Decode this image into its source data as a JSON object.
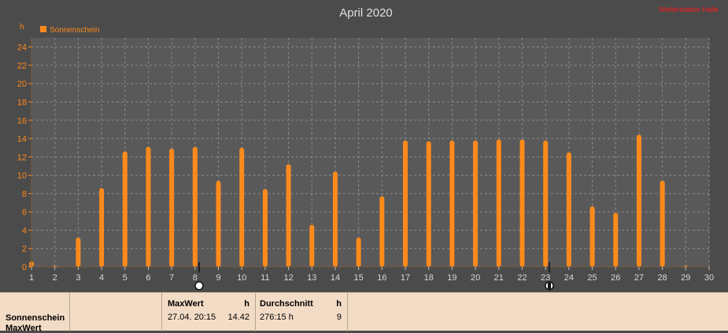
{
  "chart_data": {
    "type": "bar",
    "title": "April 2020",
    "ylabel": "h",
    "ylim": [
      0,
      25
    ],
    "yticks": [
      0,
      2,
      4,
      6,
      8,
      10,
      12,
      14,
      16,
      18,
      20,
      22,
      24
    ],
    "xlim": [
      1,
      30
    ],
    "categories": [
      "1",
      "2",
      "3",
      "4",
      "5",
      "6",
      "7",
      "8",
      "9",
      "10",
      "11",
      "12",
      "13",
      "14",
      "15",
      "16",
      "17",
      "18",
      "19",
      "20",
      "21",
      "22",
      "23",
      "24",
      "25",
      "26",
      "27",
      "28",
      "29",
      "30"
    ],
    "series": [
      {
        "name": "Sonnenschein",
        "color": "#ff8a1c",
        "x": [
          1,
          2,
          3,
          4,
          5,
          6,
          7,
          8,
          9,
          10,
          11,
          12,
          13,
          14,
          15,
          16,
          17,
          18,
          19,
          20,
          21,
          22,
          23,
          24,
          25,
          26,
          27,
          28,
          29
        ],
        "values": [
          0.6,
          0.1,
          3.2,
          8.6,
          12.6,
          13.1,
          12.9,
          13.1,
          9.4,
          13.0,
          8.5,
          11.2,
          4.6,
          10.4,
          3.2,
          7.7,
          13.8,
          13.7,
          13.8,
          13.8,
          13.9,
          13.9,
          13.8,
          12.5,
          6.6,
          5.9,
          14.42,
          9.4,
          0.1
        ]
      }
    ],
    "grid": true,
    "legend": "top-left"
  },
  "header": {
    "brand_text": "Wetterstation Halle"
  },
  "info_panel": {
    "series_label": "Sonnenschein",
    "series_sublabel": "MaxWert",
    "max": {
      "header": "MaxWert",
      "unit": "h",
      "datetime": "27.04.  20:15",
      "value": "14.42"
    },
    "average": {
      "header": "Durchschnitt",
      "unit": "h",
      "value": "276:15 h",
      "count": "9"
    }
  },
  "colors": {
    "background": "#4b4b4b",
    "plot_background": "#595959",
    "bar": "#ff8a1c",
    "axis": "#7a5a3c",
    "panel": "#f3dcc6"
  }
}
